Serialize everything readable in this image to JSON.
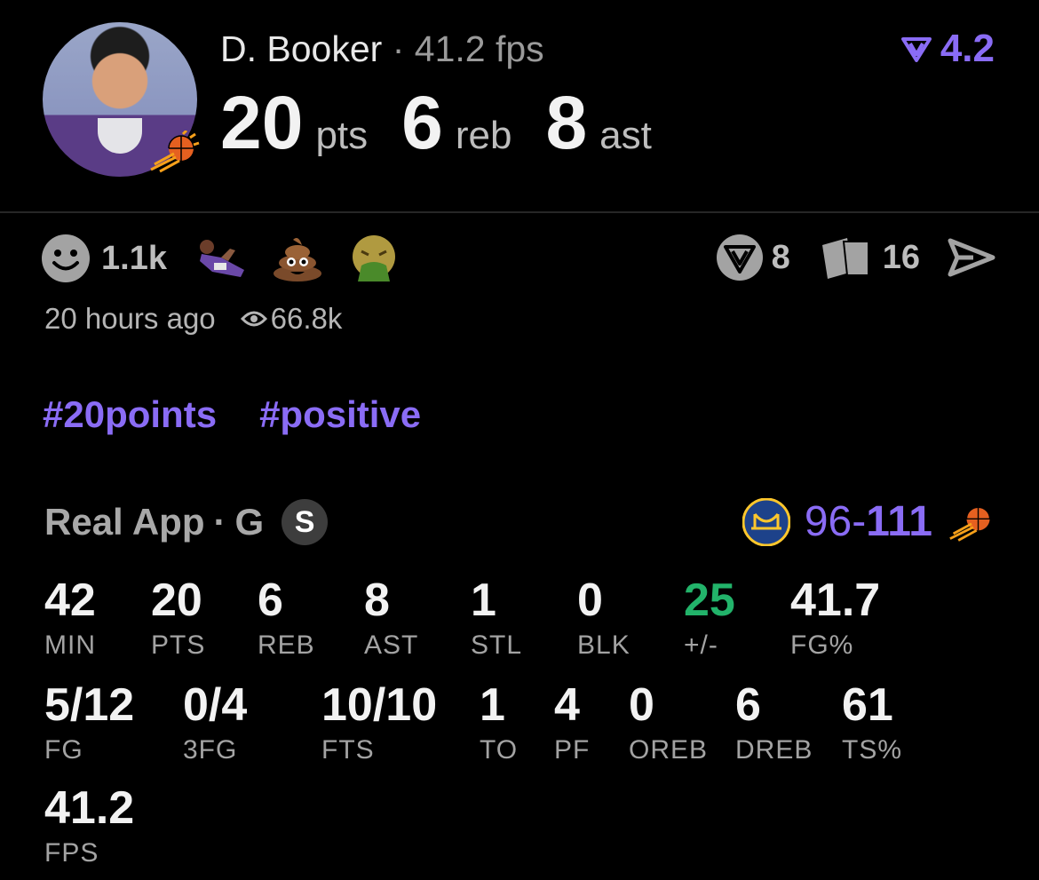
{
  "player": {
    "name": "D. Booker",
    "dot": "·",
    "fps_text": "41.2 fps",
    "rating": "4.2"
  },
  "headline": {
    "pts_value": "20",
    "pts_label": "pts",
    "reb_value": "6",
    "reb_label": "reb",
    "ast_value": "8",
    "ast_label": "ast"
  },
  "reactions": {
    "count": "1.1k",
    "emojis": [
      "player-lying-down",
      "poop-emoji",
      "vomiting-face-emoji"
    ],
    "comment_count": "8",
    "cards_count": "16"
  },
  "meta": {
    "posted": "20 hours ago",
    "views": "66.8k"
  },
  "tags": [
    "#20points",
    "#positive"
  ],
  "game": {
    "source": "Real App",
    "position": "G",
    "badge": "S",
    "score_loss": "96",
    "score_dash": "-",
    "score_win": "111"
  },
  "stats_row1": [
    {
      "value": "42",
      "label": "MIN"
    },
    {
      "value": "20",
      "label": "PTS"
    },
    {
      "value": "6",
      "label": "REB"
    },
    {
      "value": "8",
      "label": "AST"
    },
    {
      "value": "1",
      "label": "STL"
    },
    {
      "value": "0",
      "label": "BLK"
    },
    {
      "value": "25",
      "label": "+/-"
    },
    {
      "value": "41.7",
      "label": "FG%"
    }
  ],
  "stats_row2": [
    {
      "value": "5/12",
      "label": "FG"
    },
    {
      "value": "0/4",
      "label": "3FG"
    },
    {
      "value": "10/10",
      "label": "FTS"
    },
    {
      "value": "1",
      "label": "TO"
    },
    {
      "value": "4",
      "label": "PF"
    },
    {
      "value": "0",
      "label": "OREB"
    },
    {
      "value": "6",
      "label": "DREB"
    },
    {
      "value": "61",
      "label": "TS%"
    }
  ],
  "stats_row3": [
    {
      "value": "41.2",
      "label": "FPS"
    }
  ],
  "colors": {
    "accent": "#8a6cf5",
    "positive": "#22b36a",
    "background": "#000000"
  }
}
